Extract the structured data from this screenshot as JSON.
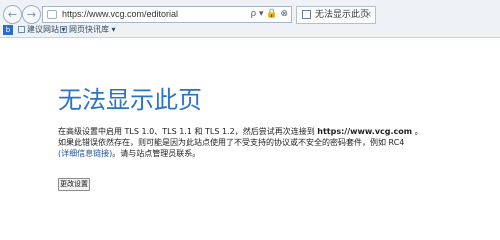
{
  "browser": {
    "address_url": "https://www.vcg.com/editorial",
    "address_tools": "ρ ▾ 🔒 ⊗",
    "tab_title": "无法显示此页",
    "tab_close": "×",
    "favorites": {
      "icon_text": "b",
      "items": [
        "建议网站 ▾",
        "网页快讯库 ▾"
      ]
    }
  },
  "page": {
    "headline": "无法显示此页",
    "message": {
      "line1_prefix": "在高级设置中启用 TLS 1.0、TLS 1.1 和 TLS 1.2，然后尝试再次连接到",
      "line1_url": "https://www.vcg.com",
      "line1_suffix": "。",
      "line2": "如果此错误依然存在，则可能是因为此站点使用了不受支持的协议或不安全的密码套件，例如 RC4",
      "line3_link": "(详细信息链接)",
      "line3_suffix": "。请与站点管理员联系。"
    },
    "button_label": "更改设置"
  },
  "icons": [
    "back-icon",
    "forward-icon",
    "page-icon",
    "search-icon",
    "lock-icon",
    "refresh-icon",
    "favorite-icon"
  ]
}
